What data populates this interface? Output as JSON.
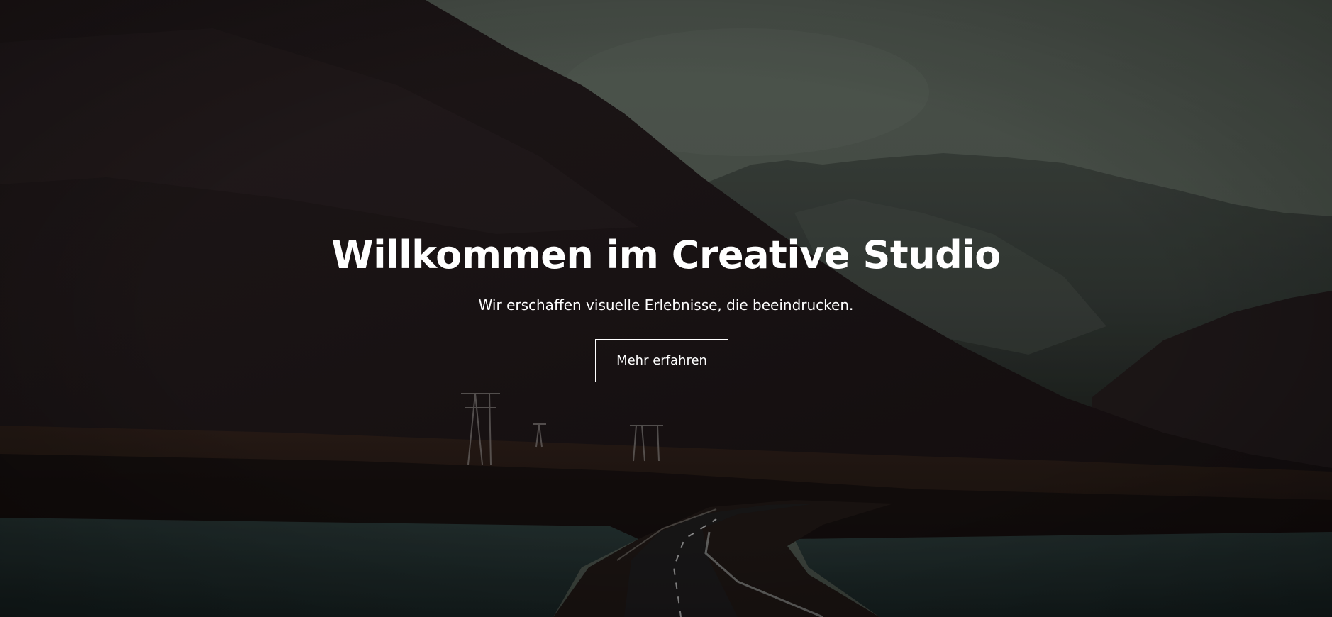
{
  "hero": {
    "title": "Willkommen im Creative Studio",
    "subtitle": "Wir erschaffen visuelle Erlebnisse, die beeindrucken.",
    "cta_label": "Mehr erfahren",
    "background_image": "dark-mountain-valley-road-photo"
  },
  "colors": {
    "text": "#ffffff",
    "button_border": "#ffffff",
    "sky": "#4f574f",
    "mountain_dark": "#1f1718",
    "water": "#1e2a29"
  }
}
